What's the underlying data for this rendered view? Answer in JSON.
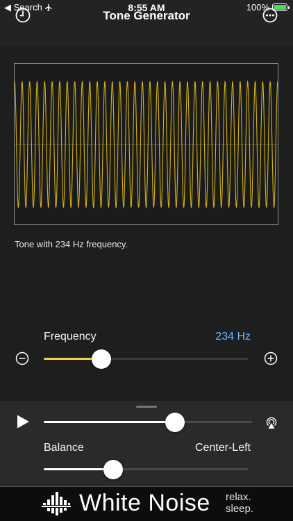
{
  "status_bar": {
    "back_label": "◀ Search",
    "time": "8:55 AM",
    "battery_text": "100%"
  },
  "nav": {
    "title": "Tone Generator"
  },
  "tone": {
    "description": "Tone with 234 Hz frequency."
  },
  "frequency": {
    "label": "Frequency",
    "value_text": "234 Hz",
    "slider_fraction": 0.28,
    "accent_color": "#f5d33b"
  },
  "playback": {
    "slider_fraction": 0.63
  },
  "balance": {
    "label": "Balance",
    "value_text": "Center-Left",
    "slider_fraction": 0.34
  },
  "ad": {
    "title": "White Noise",
    "tagline_line1": "relax.",
    "tagline_line2": "sleep."
  },
  "colors": {
    "wave": "#d4b21c",
    "link_blue": "#6ab4ff"
  }
}
